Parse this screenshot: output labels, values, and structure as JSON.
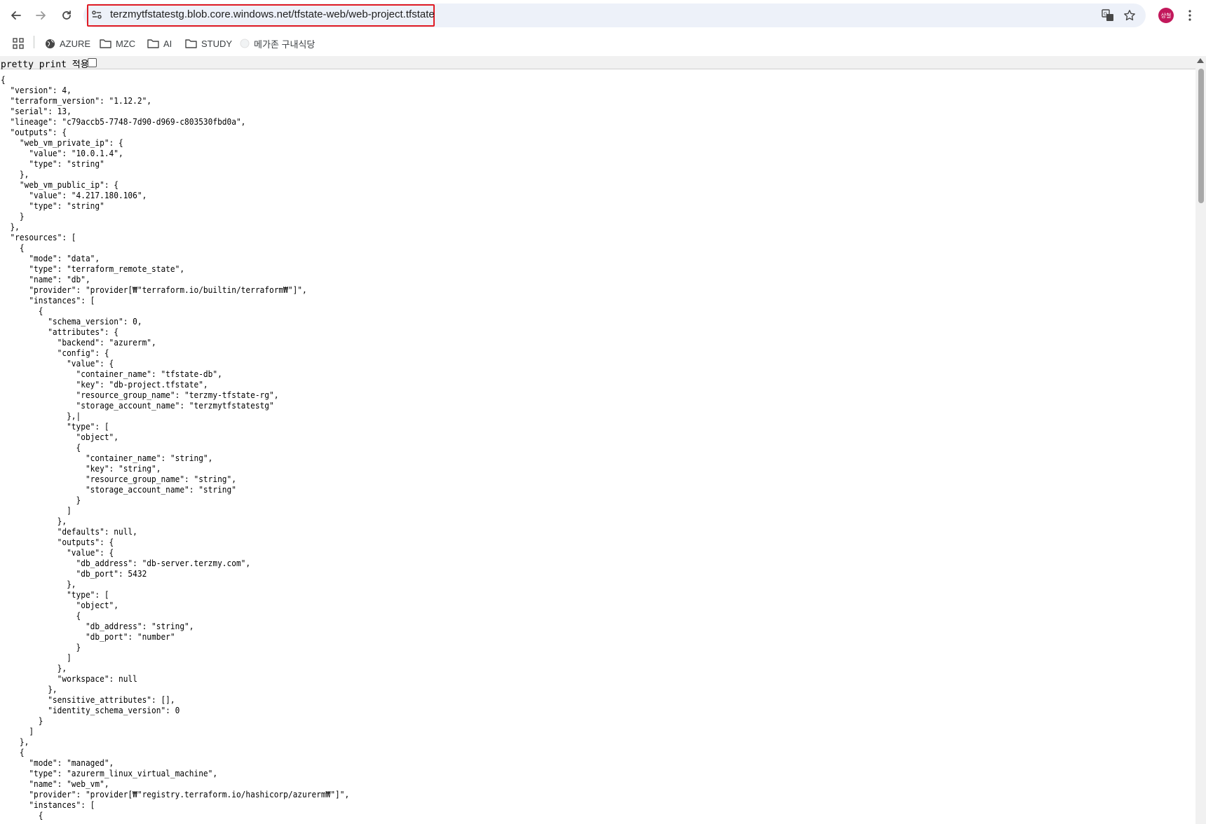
{
  "browser": {
    "url": "terzmytfstatestg.blob.core.windows.net/tfstate-web/web-project.tfstate",
    "avatar_label": "상철",
    "bookmarks": [
      {
        "label": "",
        "icon": "apps-grid-icon"
      },
      {
        "label": "AZURE",
        "icon": "globe-icon"
      },
      {
        "label": "MZC",
        "icon": "folder-icon"
      },
      {
        "label": "AI",
        "icon": "folder-icon"
      },
      {
        "label": "STUDY",
        "icon": "folder-icon"
      },
      {
        "label": "메가존 구내식당",
        "icon": "site-favicon-icon"
      }
    ]
  },
  "pretty_print": {
    "label": "pretty print 적용",
    "checked": false
  },
  "json_text": "{\n  \"version\": 4,\n  \"terraform_version\": \"1.12.2\",\n  \"serial\": 13,\n  \"lineage\": \"c79accb5-7748-7d90-d969-c803530fbd0a\",\n  \"outputs\": {\n    \"web_vm_private_ip\": {\n      \"value\": \"10.0.1.4\",\n      \"type\": \"string\"\n    },\n    \"web_vm_public_ip\": {\n      \"value\": \"4.217.180.106\",\n      \"type\": \"string\"\n    }\n  },\n  \"resources\": [\n    {\n      \"mode\": \"data\",\n      \"type\": \"terraform_remote_state\",\n      \"name\": \"db\",\n      \"provider\": \"provider[₩\"terraform.io/builtin/terraform₩\"]\",\n      \"instances\": [\n        {\n          \"schema_version\": 0,\n          \"attributes\": {\n            \"backend\": \"azurerm\",\n            \"config\": {\n              \"value\": {\n                \"container_name\": \"tfstate-db\",\n                \"key\": \"db-project.tfstate\",\n                \"resource_group_name\": \"terzmy-tfstate-rg\",\n                \"storage_account_name\": \"terzmytfstatestg\"\n              },|\n              \"type\": [\n                \"object\",\n                {\n                  \"container_name\": \"string\",\n                  \"key\": \"string\",\n                  \"resource_group_name\": \"string\",\n                  \"storage_account_name\": \"string\"\n                }\n              ]\n            },\n            \"defaults\": null,\n            \"outputs\": {\n              \"value\": {\n                \"db_address\": \"db-server.terzmy.com\",\n                \"db_port\": 5432\n              },\n              \"type\": [\n                \"object\",\n                {\n                  \"db_address\": \"string\",\n                  \"db_port\": \"number\"\n                }\n              ]\n            },\n            \"workspace\": null\n          },\n          \"sensitive_attributes\": [],\n          \"identity_schema_version\": 0\n        }\n      ]\n    },\n    {\n      \"mode\": \"managed\",\n      \"type\": \"azurerm_linux_virtual_machine\",\n      \"name\": \"web_vm\",\n      \"provider\": \"provider[₩\"registry.terraform.io/hashicorp/azurerm₩\"]\",\n      \"instances\": [\n        {"
}
